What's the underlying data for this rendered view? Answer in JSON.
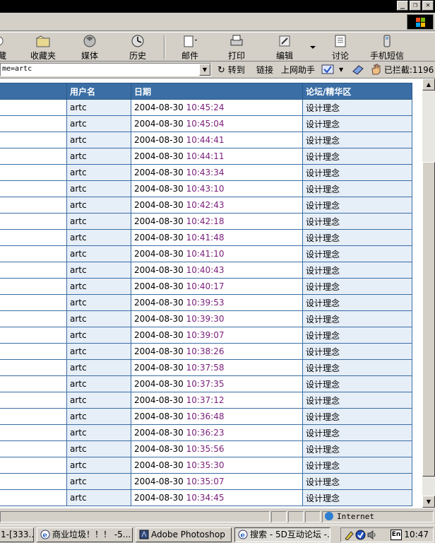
{
  "toolbar": {
    "items": [
      {
        "label": "藏",
        "icon": "favorites-icon"
      },
      {
        "label": "收藏夹",
        "icon": "folder-favorites-icon"
      },
      {
        "label": "媒体",
        "icon": "media-icon"
      },
      {
        "label": "历史",
        "icon": "history-icon"
      },
      {
        "label": "邮件",
        "icon": "mail-icon"
      },
      {
        "label": "打印",
        "icon": "print-icon"
      },
      {
        "label": "编辑",
        "icon": "edit-icon"
      },
      {
        "label": "讨论",
        "icon": "discuss-icon"
      },
      {
        "label": "手机短信",
        "icon": "sms-icon"
      }
    ]
  },
  "address": {
    "value": "me=artc",
    "go_label": "转到",
    "links_label": "链接",
    "helper_label": "上网助手",
    "blocked_label": "已拦截:1196"
  },
  "table": {
    "headers": [
      "",
      "用户名",
      "日期",
      "论坛/精华区"
    ],
    "rows": [
      {
        "user": "artc",
        "date": "2004-08-30",
        "time": "10:45:24",
        "forum": "设计理念"
      },
      {
        "user": "artc",
        "date": "2004-08-30",
        "time": "10:45:04",
        "forum": "设计理念"
      },
      {
        "user": "artc",
        "date": "2004-08-30",
        "time": "10:44:41",
        "forum": "设计理念"
      },
      {
        "user": "artc",
        "date": "2004-08-30",
        "time": "10:44:11",
        "forum": "设计理念"
      },
      {
        "user": "artc",
        "date": "2004-08-30",
        "time": "10:43:34",
        "forum": "设计理念"
      },
      {
        "user": "artc",
        "date": "2004-08-30",
        "time": "10:43:10",
        "forum": "设计理念"
      },
      {
        "user": "artc",
        "date": "2004-08-30",
        "time": "10:42:43",
        "forum": "设计理念"
      },
      {
        "user": "artc",
        "date": "2004-08-30",
        "time": "10:42:18",
        "forum": "设计理念"
      },
      {
        "user": "artc",
        "date": "2004-08-30",
        "time": "10:41:48",
        "forum": "设计理念"
      },
      {
        "user": "artc",
        "date": "2004-08-30",
        "time": "10:41:10",
        "forum": "设计理念"
      },
      {
        "user": "artc",
        "date": "2004-08-30",
        "time": "10:40:43",
        "forum": "设计理念"
      },
      {
        "user": "artc",
        "date": "2004-08-30",
        "time": "10:40:17",
        "forum": "设计理念"
      },
      {
        "user": "artc",
        "date": "2004-08-30",
        "time": "10:39:53",
        "forum": "设计理念"
      },
      {
        "user": "artc",
        "date": "2004-08-30",
        "time": "10:39:30",
        "forum": "设计理念"
      },
      {
        "user": "artc",
        "date": "2004-08-30",
        "time": "10:39:07",
        "forum": "设计理念"
      },
      {
        "user": "artc",
        "date": "2004-08-30",
        "time": "10:38:26",
        "forum": "设计理念"
      },
      {
        "user": "artc",
        "date": "2004-08-30",
        "time": "10:37:58",
        "forum": "设计理念"
      },
      {
        "user": "artc",
        "date": "2004-08-30",
        "time": "10:37:35",
        "forum": "设计理念"
      },
      {
        "user": "artc",
        "date": "2004-08-30",
        "time": "10:37:12",
        "forum": "设计理念"
      },
      {
        "user": "artc",
        "date": "2004-08-30",
        "time": "10:36:48",
        "forum": "设计理念"
      },
      {
        "user": "artc",
        "date": "2004-08-30",
        "time": "10:36:23",
        "forum": "设计理念"
      },
      {
        "user": "artc",
        "date": "2004-08-30",
        "time": "10:35:56",
        "forum": "设计理念"
      },
      {
        "user": "artc",
        "date": "2004-08-30",
        "time": "10:35:30",
        "forum": "设计理念"
      },
      {
        "user": "artc",
        "date": "2004-08-30",
        "time": "10:35:07",
        "forum": "设计理念"
      },
      {
        "user": "artc",
        "date": "2004-08-30",
        "time": "10:34:45",
        "forum": "设计理念"
      }
    ]
  },
  "status": {
    "zone_label": "Internet"
  },
  "taskbar": {
    "tasks": [
      {
        "label": "1-[333...",
        "active": false
      },
      {
        "label": "商业垃圾！！！ -5...",
        "active": false
      },
      {
        "label": "Adobe Photoshop",
        "active": false
      },
      {
        "label": "搜索 - 5D互动论坛 -...",
        "active": true
      }
    ],
    "lang": "En",
    "clock": "10:47"
  },
  "colors": {
    "header_bg": "#3a6ea5",
    "time_text": "#7a1f7a",
    "alt_col_bg": "#e6eef7"
  }
}
